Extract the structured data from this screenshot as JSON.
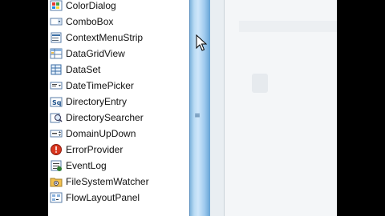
{
  "toolbox": {
    "items": [
      {
        "label": "ColorDialog",
        "icon": "color-dialog-icon"
      },
      {
        "label": "ComboBox",
        "icon": "combobox-icon"
      },
      {
        "label": "ContextMenuStrip",
        "icon": "context-menu-strip-icon"
      },
      {
        "label": "DataGridView",
        "icon": "datagridview-icon"
      },
      {
        "label": "DataSet",
        "icon": "dataset-icon"
      },
      {
        "label": "DateTimePicker",
        "icon": "datetimepicker-icon"
      },
      {
        "label": "DirectoryEntry",
        "icon": "directory-entry-icon"
      },
      {
        "label": "DirectorySearcher",
        "icon": "directory-searcher-icon"
      },
      {
        "label": "DomainUpDown",
        "icon": "domain-updown-icon"
      },
      {
        "label": "ErrorProvider",
        "icon": "error-provider-icon"
      },
      {
        "label": "EventLog",
        "icon": "eventlog-icon"
      },
      {
        "label": "FileSystemWatcher",
        "icon": "filesystemwatcher-icon"
      },
      {
        "label": "FlowLayoutPanel",
        "icon": "flowlayoutpanel-icon"
      }
    ]
  },
  "splitter": {
    "grip_glyph": "≡"
  },
  "colors": {
    "splitter_blue": "#9fcaee",
    "error_red": "#d9361f"
  }
}
